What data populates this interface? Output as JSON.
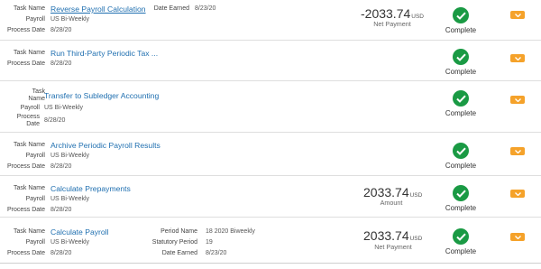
{
  "labels": {
    "task_name": "Task Name",
    "task_name_wrap1": "Task",
    "task_name_wrap2": "Name",
    "payroll": "Payroll",
    "process_date": "Process Date",
    "process_wrap1": "Process",
    "process_wrap2": "Date",
    "date_earned": "Date Earned",
    "period_name": "Period Name",
    "statutory_period": "Statutory Period"
  },
  "colors": {
    "link": "#1f6fb0",
    "success": "#1a9a44",
    "action": "#f5a22a"
  },
  "tasks": [
    {
      "task_name": "Reverse Payroll Calculation",
      "payroll": "US Bi-Weekly",
      "process_date": "8/28/20",
      "date_earned": "8/23/20",
      "amount": "-2033.74",
      "currency": "USD",
      "amount_label": "Net Payment",
      "status": "Complete",
      "status_icon": "check-circle-icon",
      "action_icon": "chevron-down-icon"
    },
    {
      "task_name": "Run Third-Party Periodic Tax ...",
      "process_date": "8/28/20",
      "status": "Complete"
    },
    {
      "task_name": "Transfer to Subledger Accounting",
      "payroll": "US Bi-Weekly",
      "process_date": "8/28/20",
      "status": "Complete"
    },
    {
      "task_name": "Archive Periodic Payroll Results",
      "payroll": "US Bi-Weekly",
      "process_date": "8/28/20",
      "status": "Complete"
    },
    {
      "task_name": "Calculate Prepayments",
      "payroll": "US Bi-Weekly",
      "process_date": "8/28/20",
      "amount": "2033.74",
      "currency": "USD",
      "amount_label": "Amount",
      "status": "Complete"
    },
    {
      "task_name": "Calculate Payroll",
      "payroll": "US Bi-Weekly",
      "process_date": "8/28/20",
      "period_name": "18 2020 Biweekly",
      "statutory_period": "19",
      "date_earned": "8/23/20",
      "amount": "2033.74",
      "currency": "USD",
      "amount_label": "Net Payment",
      "status": "Complete"
    }
  ]
}
